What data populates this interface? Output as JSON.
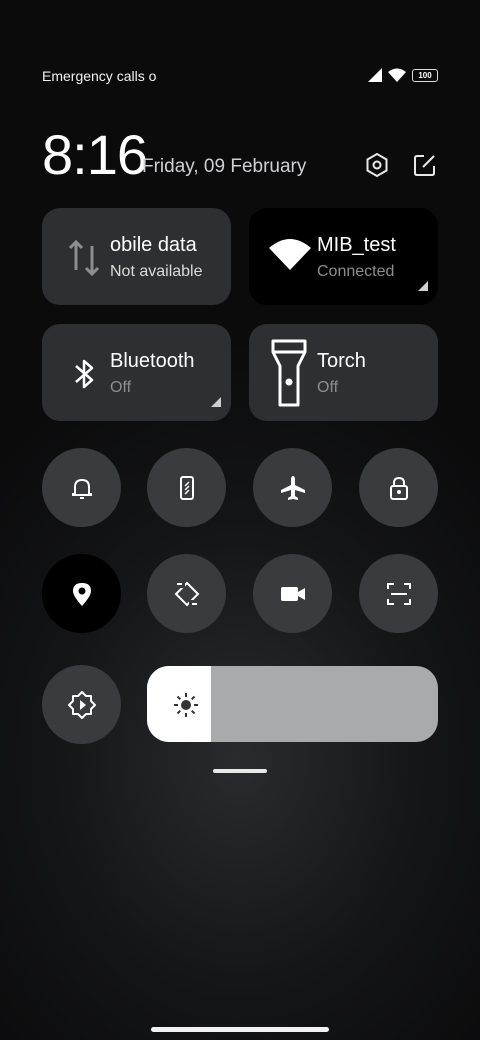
{
  "status_bar": {
    "carrier_text": "Emergency calls o",
    "battery": "100"
  },
  "header": {
    "time": "8:16",
    "date": "Friday, 09 February"
  },
  "tiles": {
    "mobile_data": {
      "title": "obile data",
      "subtitle": "Not available"
    },
    "wifi": {
      "title": "MIB_test",
      "subtitle": "Connected"
    },
    "bluetooth": {
      "title": "Bluetooth",
      "subtitle": "Off"
    },
    "torch": {
      "title": "Torch",
      "subtitle": "Off"
    }
  },
  "toggles": [
    "bell-icon",
    "vibrate-icon",
    "airplane-icon",
    "lock-icon",
    "location-icon",
    "auto-rotate-icon",
    "video-icon",
    "scanner-icon",
    "auto-brightness-icon"
  ],
  "brightness": {
    "level": 0.22
  },
  "colors": {
    "tile": "#2e2f32",
    "round": "#3a3b3e",
    "active": "#000000",
    "slider_track": "#a9aaac"
  }
}
